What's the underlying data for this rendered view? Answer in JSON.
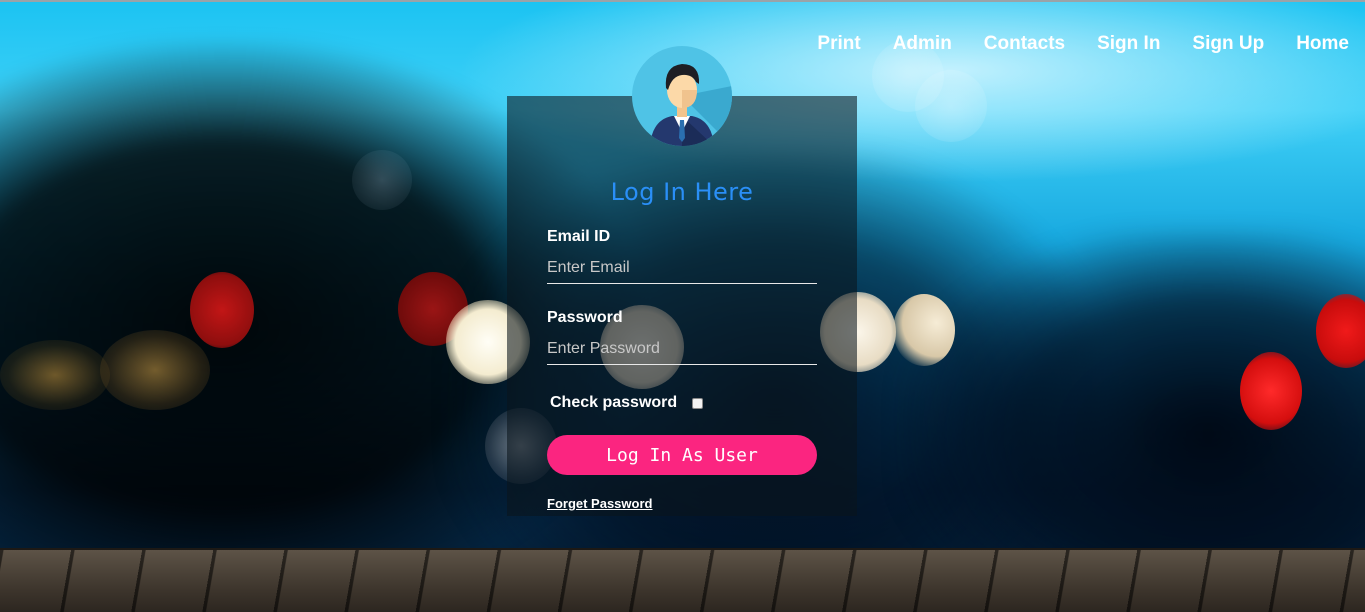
{
  "nav": {
    "items": [
      {
        "label": "Print"
      },
      {
        "label": "Admin"
      },
      {
        "label": "Contacts"
      },
      {
        "label": "Sign In"
      },
      {
        "label": "Sign Up"
      },
      {
        "label": "Home"
      }
    ]
  },
  "login": {
    "title": "Log In Here",
    "email_label": "Email ID",
    "email_placeholder": "Enter Email",
    "email_value": "",
    "password_label": "Password",
    "password_placeholder": "Enter Password",
    "password_value": "",
    "check_label": "Check password",
    "check_checked": false,
    "button_label": "Log In As User",
    "forget_label": "Forget Password"
  },
  "colors": {
    "button": "#fb2580",
    "title": "#2a8ff7",
    "avatar_bg": "#4fc3e6"
  },
  "icons": {
    "avatar": "user-avatar-icon",
    "checkbox": "checkbox-icon"
  }
}
